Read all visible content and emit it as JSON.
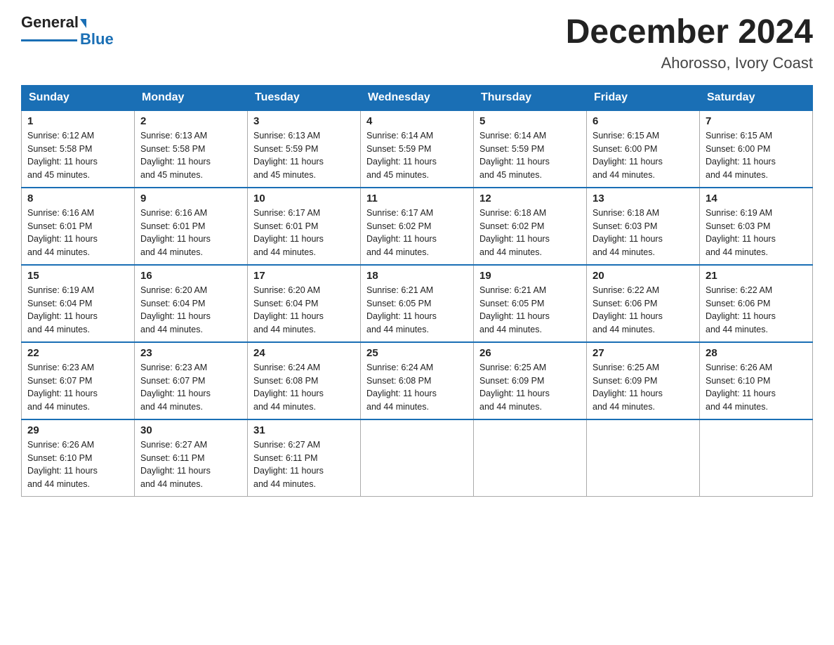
{
  "logo": {
    "text_general": "General",
    "text_blue": "Blue"
  },
  "header": {
    "month": "December 2024",
    "location": "Ahorosso, Ivory Coast"
  },
  "days_of_week": [
    "Sunday",
    "Monday",
    "Tuesday",
    "Wednesday",
    "Thursday",
    "Friday",
    "Saturday"
  ],
  "weeks": [
    [
      {
        "day": "1",
        "sunrise": "6:12 AM",
        "sunset": "5:58 PM",
        "daylight": "11 hours and 45 minutes."
      },
      {
        "day": "2",
        "sunrise": "6:13 AM",
        "sunset": "5:58 PM",
        "daylight": "11 hours and 45 minutes."
      },
      {
        "day": "3",
        "sunrise": "6:13 AM",
        "sunset": "5:59 PM",
        "daylight": "11 hours and 45 minutes."
      },
      {
        "day": "4",
        "sunrise": "6:14 AM",
        "sunset": "5:59 PM",
        "daylight": "11 hours and 45 minutes."
      },
      {
        "day": "5",
        "sunrise": "6:14 AM",
        "sunset": "5:59 PM",
        "daylight": "11 hours and 45 minutes."
      },
      {
        "day": "6",
        "sunrise": "6:15 AM",
        "sunset": "6:00 PM",
        "daylight": "11 hours and 44 minutes."
      },
      {
        "day": "7",
        "sunrise": "6:15 AM",
        "sunset": "6:00 PM",
        "daylight": "11 hours and 44 minutes."
      }
    ],
    [
      {
        "day": "8",
        "sunrise": "6:16 AM",
        "sunset": "6:01 PM",
        "daylight": "11 hours and 44 minutes."
      },
      {
        "day": "9",
        "sunrise": "6:16 AM",
        "sunset": "6:01 PM",
        "daylight": "11 hours and 44 minutes."
      },
      {
        "day": "10",
        "sunrise": "6:17 AM",
        "sunset": "6:01 PM",
        "daylight": "11 hours and 44 minutes."
      },
      {
        "day": "11",
        "sunrise": "6:17 AM",
        "sunset": "6:02 PM",
        "daylight": "11 hours and 44 minutes."
      },
      {
        "day": "12",
        "sunrise": "6:18 AM",
        "sunset": "6:02 PM",
        "daylight": "11 hours and 44 minutes."
      },
      {
        "day": "13",
        "sunrise": "6:18 AM",
        "sunset": "6:03 PM",
        "daylight": "11 hours and 44 minutes."
      },
      {
        "day": "14",
        "sunrise": "6:19 AM",
        "sunset": "6:03 PM",
        "daylight": "11 hours and 44 minutes."
      }
    ],
    [
      {
        "day": "15",
        "sunrise": "6:19 AM",
        "sunset": "6:04 PM",
        "daylight": "11 hours and 44 minutes."
      },
      {
        "day": "16",
        "sunrise": "6:20 AM",
        "sunset": "6:04 PM",
        "daylight": "11 hours and 44 minutes."
      },
      {
        "day": "17",
        "sunrise": "6:20 AM",
        "sunset": "6:04 PM",
        "daylight": "11 hours and 44 minutes."
      },
      {
        "day": "18",
        "sunrise": "6:21 AM",
        "sunset": "6:05 PM",
        "daylight": "11 hours and 44 minutes."
      },
      {
        "day": "19",
        "sunrise": "6:21 AM",
        "sunset": "6:05 PM",
        "daylight": "11 hours and 44 minutes."
      },
      {
        "day": "20",
        "sunrise": "6:22 AM",
        "sunset": "6:06 PM",
        "daylight": "11 hours and 44 minutes."
      },
      {
        "day": "21",
        "sunrise": "6:22 AM",
        "sunset": "6:06 PM",
        "daylight": "11 hours and 44 minutes."
      }
    ],
    [
      {
        "day": "22",
        "sunrise": "6:23 AM",
        "sunset": "6:07 PM",
        "daylight": "11 hours and 44 minutes."
      },
      {
        "day": "23",
        "sunrise": "6:23 AM",
        "sunset": "6:07 PM",
        "daylight": "11 hours and 44 minutes."
      },
      {
        "day": "24",
        "sunrise": "6:24 AM",
        "sunset": "6:08 PM",
        "daylight": "11 hours and 44 minutes."
      },
      {
        "day": "25",
        "sunrise": "6:24 AM",
        "sunset": "6:08 PM",
        "daylight": "11 hours and 44 minutes."
      },
      {
        "day": "26",
        "sunrise": "6:25 AM",
        "sunset": "6:09 PM",
        "daylight": "11 hours and 44 minutes."
      },
      {
        "day": "27",
        "sunrise": "6:25 AM",
        "sunset": "6:09 PM",
        "daylight": "11 hours and 44 minutes."
      },
      {
        "day": "28",
        "sunrise": "6:26 AM",
        "sunset": "6:10 PM",
        "daylight": "11 hours and 44 minutes."
      }
    ],
    [
      {
        "day": "29",
        "sunrise": "6:26 AM",
        "sunset": "6:10 PM",
        "daylight": "11 hours and 44 minutes."
      },
      {
        "day": "30",
        "sunrise": "6:27 AM",
        "sunset": "6:11 PM",
        "daylight": "11 hours and 44 minutes."
      },
      {
        "day": "31",
        "sunrise": "6:27 AM",
        "sunset": "6:11 PM",
        "daylight": "11 hours and 44 minutes."
      },
      null,
      null,
      null,
      null
    ]
  ],
  "labels": {
    "sunrise": "Sunrise:",
    "sunset": "Sunset:",
    "daylight": "Daylight:"
  }
}
